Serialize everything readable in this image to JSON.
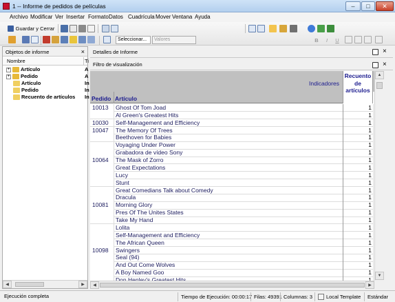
{
  "window": {
    "title": "1 -- Informe de pedidos de películas"
  },
  "menu": [
    "Archivo",
    "Modificar",
    "Ver",
    "Insertar",
    "Formato",
    "Datos",
    "Cuadrícula",
    "Mover",
    "Ventana",
    "Ayuda"
  ],
  "toolbar": {
    "save_close_label": "Guardar y Cerrar",
    "select_combo": "Seleccionar...",
    "values_combo": "Valores",
    "format_buttons": [
      "B",
      "I",
      "U"
    ]
  },
  "left_panel": {
    "title": "Objetos de informe",
    "col_name": "Nombre",
    "col_type": "Ti",
    "items": [
      {
        "label": "Artículo",
        "type": "A",
        "bold": true,
        "expand": true
      },
      {
        "label": "Pedido",
        "type": "A",
        "bold": true,
        "expand": true
      },
      {
        "label": "Artículo",
        "type": "In",
        "bold": false,
        "expand": false
      },
      {
        "label": "Pedido",
        "type": "In",
        "bold": false,
        "expand": false
      },
      {
        "label": "Recuento de artículos",
        "type": "In",
        "bold": false,
        "expand": false
      }
    ]
  },
  "right_panel": {
    "title": "Detalles de Informe",
    "filter_title": "Filtro de visualización",
    "close": "×"
  },
  "grid": {
    "indicators_label": "Indicadores",
    "metric_header": [
      "Recuento",
      "de",
      "artículos"
    ],
    "col_order": "Pedido",
    "col_item": "Artículo",
    "rows": [
      {
        "order": "10013",
        "item": "Ghost Of Tom Joad",
        "count": "1"
      },
      {
        "order": "",
        "item": "Al Green's Greatest Hits",
        "count": "1"
      },
      {
        "order": "10030",
        "item": "Self-Management and Efficiency",
        "count": "1"
      },
      {
        "order": "10047",
        "item": "The Memory Of Trees",
        "count": "1"
      },
      {
        "order": "",
        "item": "Beethoven for Babies",
        "count": "1"
      },
      {
        "order": "",
        "item": "Voyaging Under Power",
        "count": "1"
      },
      {
        "order": "",
        "item": "Grabadora de vídeo Sony",
        "count": "1"
      },
      {
        "order": "10064",
        "item": "The Mask of Zorro",
        "count": "1"
      },
      {
        "order": "",
        "item": "Great Expectations",
        "count": "1"
      },
      {
        "order": "",
        "item": "Lucy",
        "count": "1"
      },
      {
        "order": "",
        "item": "Stunt",
        "count": "1"
      },
      {
        "order": "",
        "item": "Great Comedians Talk about Comedy",
        "count": "1"
      },
      {
        "order": "",
        "item": "Dracula",
        "count": "1"
      },
      {
        "order": "10081",
        "item": "Morning Glory",
        "count": "1"
      },
      {
        "order": "",
        "item": "Pres Of The Unites States",
        "count": "1"
      },
      {
        "order": "",
        "item": "Take My Hand",
        "count": "1"
      },
      {
        "order": "",
        "item": "Lolita",
        "count": "1"
      },
      {
        "order": "",
        "item": "Self-Management and Efficiency",
        "count": "1"
      },
      {
        "order": "",
        "item": "The African Queen",
        "count": "1"
      },
      {
        "order": "10098",
        "item": "Swingers",
        "count": "1"
      },
      {
        "order": "",
        "item": "Seal (94)",
        "count": "1"
      },
      {
        "order": "",
        "item": "And Out Come Wolves",
        "count": "1"
      },
      {
        "order": "",
        "item": "A Boy Named Goo",
        "count": "1"
      },
      {
        "order": "",
        "item": "Don Henley's Greatest Hits",
        "count": "1"
      }
    ]
  },
  "status": {
    "state": "Ejecución completa",
    "exec_time": "Tiempo de Ejecución: 00:00:17",
    "rows": "Filas: 49391",
    "cols": "Columnas: 3",
    "template": "Local Template",
    "style": "Estándar"
  }
}
